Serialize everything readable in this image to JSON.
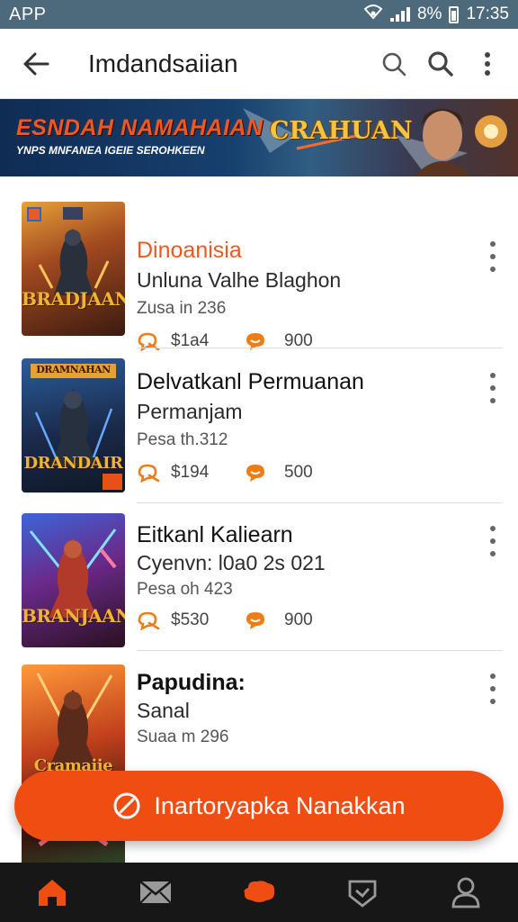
{
  "status_bar": {
    "app_label": "APP",
    "battery": "8%",
    "time": "17:35"
  },
  "app_bar": {
    "title": "Imdandsaiian"
  },
  "banner": {
    "title": "ESNDAH NAMAHAIAN",
    "subtitle": "YNPS MNFANEA IGEIE SEROHKEEN",
    "logo_text": "CRAHUAN"
  },
  "games": [
    {
      "cover_title": "BRADJAAN",
      "name": "Dinoanisia",
      "subtitle": "Unluna Valhe Blaghon",
      "meta": "Zusa in 236",
      "price": "$1a4",
      "count": "900",
      "accent": "#ea5a1f"
    },
    {
      "cover_title": "DRANDAIR",
      "cover_banner": "DRAMNAHAN",
      "name": "Delvatkanl Permuanan",
      "subtitle": "Permanjam",
      "meta": "Pesa th.312",
      "price": "$194",
      "count": "500"
    },
    {
      "cover_title": "BRANJAAN",
      "name": "Eitkanl Kaliearn",
      "subtitle": "Cyenvn: l0a0 2s 021",
      "meta": "Pesa oh 423",
      "price": "$530",
      "count": "900"
    },
    {
      "cover_title": "Cramaiie",
      "name": "Papudina:",
      "subtitle": "Sanal",
      "meta": "Suaa m 296",
      "price": "",
      "count": ""
    }
  ],
  "fab": {
    "label": "Inartoryapka Nanakkan"
  },
  "bottom_nav": {
    "items": [
      {
        "name": "home",
        "icon": "home-icon",
        "active": true
      },
      {
        "name": "mail",
        "icon": "mail-icon",
        "active": false
      },
      {
        "name": "chat",
        "icon": "chat-icon",
        "active": false
      },
      {
        "name": "badge",
        "icon": "shield-icon",
        "active": false
      },
      {
        "name": "profile",
        "icon": "profile-icon",
        "active": false
      }
    ]
  },
  "colors": {
    "accent": "#f04d12",
    "status_bar": "#4d6a7c",
    "nav_bg": "#171717"
  }
}
